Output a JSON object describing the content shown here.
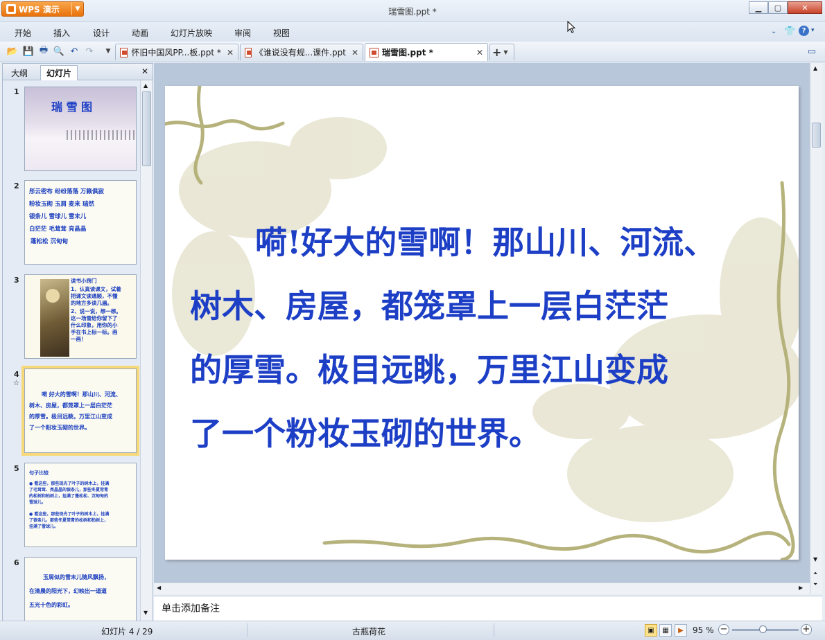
{
  "app": {
    "title": "瑞雪图.ppt *",
    "brand": "WPS 演示"
  },
  "menu": [
    "开始",
    "插入",
    "设计",
    "动画",
    "幻灯片放映",
    "审阅",
    "视图"
  ],
  "tabs": [
    {
      "label": "怀旧中国风PP...板.ppt *"
    },
    {
      "label": "《谁说没有规...课件.ppt"
    },
    {
      "label": "瑞雪图.ppt *"
    }
  ],
  "panel": {
    "tab_outline": "大纲",
    "tab_slides": "幻灯片"
  },
  "thumbs": [
    {
      "num": "1",
      "title": "瑞 雪 图"
    },
    {
      "num": "2",
      "lines": [
        "彤云密布  纷纷落落  万籁俱寂",
        "粉妆玉砌  玉屑  麦来  瑞然",
        "银条儿  雪球儿  雪末儿",
        "白茫茫  毛茸茸  亮晶晶",
        "蓬松松  沉甸甸"
      ]
    },
    {
      "num": "3",
      "lines": [
        "读书小窍门",
        "1、认真读课文，试着",
        "把课文读通顺，不懂",
        "的地方多读几遍。",
        "2、说一说，想一想。",
        "这一场雪给你留下了",
        "什么印象，用你的小",
        "手在书上标一标。画",
        "一画！"
      ]
    },
    {
      "num": "4",
      "lines": [
        "嗬 好大的雪啊！那山川、河流、",
        "树木、房屋，都笼罩上一层白茫茫",
        "的厚雪。极目远眺，万里江山变成",
        "了一个粉妆玉砌的世界。"
      ]
    },
    {
      "num": "5",
      "lines": [
        "句子比较",
        "● 看这些，那些现光了叶子的树木上，挂满",
        "了毛茸茸、亮晶晶的银条儿，那些冬夏常青",
        "的松树和柏树上，挂满了蓬松松、沉甸甸的",
        "雪球儿。",
        "● 看这些，那些现光了叶子的树木上，挂满",
        "了银条儿，那些冬夏常青的松树和柏树上，",
        "挂满了雪球儿。"
      ]
    },
    {
      "num": "6",
      "lines": [
        "玉屑似的雪末儿随风飘扬，",
        "在清晨的阳光下，幻映出一道道",
        "五光十色的彩虹。"
      ]
    }
  ],
  "slide": {
    "lines": [
      "嗬!好大的雪啊！那山川、河流、",
      "树木、房屋，都笼罩上一层白茫茫",
      "的厚雪。极目远眺，万里江山变成",
      "了一个粉妆玉砌的世界。"
    ]
  },
  "notes": {
    "placeholder": "单击添加备注"
  },
  "status": {
    "slide": "幻灯片 4 / 29",
    "theme": "古瓶荷花",
    "zoom": "95 %"
  },
  "colors": {
    "accent": "#1d3fc6",
    "highlight": "#e0401f",
    "brand": "#e8720c"
  }
}
